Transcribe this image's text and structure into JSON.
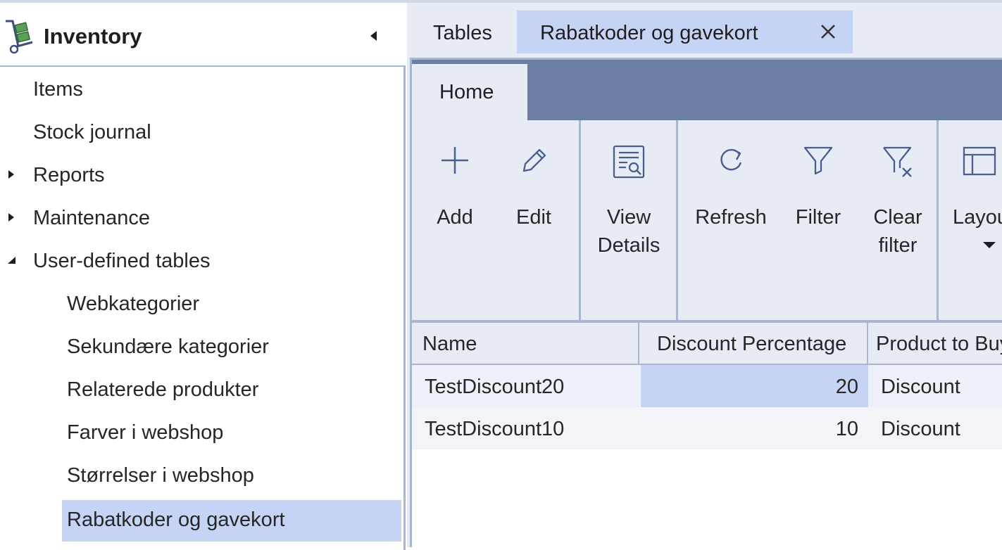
{
  "sidebar": {
    "title": "Inventory",
    "items": [
      {
        "label": "Items"
      },
      {
        "label": "Stock journal"
      },
      {
        "label": "Reports"
      },
      {
        "label": "Maintenance"
      },
      {
        "label": "User-defined tables"
      },
      {
        "label": "Webkategorier"
      },
      {
        "label": "Sekundære kategorier"
      },
      {
        "label": "Relaterede produkter"
      },
      {
        "label": "Farver i webshop"
      },
      {
        "label": "Størrelser i webshop"
      },
      {
        "label": "Rabatkoder og gavekort"
      }
    ]
  },
  "doc_tabs": {
    "tables": "Tables",
    "active": "Rabatkoder og gavekort"
  },
  "ribbon": {
    "tab_home": "Home",
    "buttons": {
      "add": "Add",
      "edit": "Edit",
      "view_details": "View Details",
      "refresh": "Refresh",
      "filter": "Filter",
      "clear_filter": "Clear filter",
      "layout": "Layout"
    }
  },
  "grid": {
    "columns": [
      "Name",
      "Discount Percentage",
      "Product to Buy"
    ],
    "rows": [
      {
        "name": "TestDiscount20",
        "pct": "20",
        "product": "Discount"
      },
      {
        "name": "TestDiscount10",
        "pct": "10",
        "product": "Discount"
      }
    ]
  },
  "colors": {
    "accent": "#c5d3f5",
    "ribbon_band": "#6c7ea4",
    "border": "#a9b6d0",
    "panel": "#e7ebf4"
  }
}
